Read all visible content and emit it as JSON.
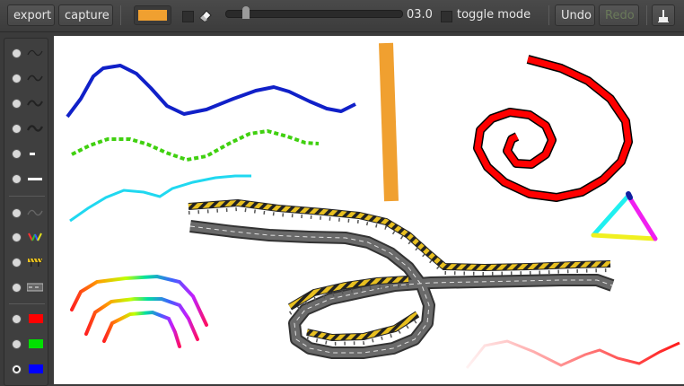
{
  "toolbar": {
    "export_label": "export",
    "capture_label": "capture",
    "current_color": "#f0a030",
    "eraser_icon": "eraser-icon",
    "brush_size": "03.0",
    "toggle_mode_label": "toggle mode",
    "undo_label": "Undo",
    "redo_label": "Redo",
    "clear_icon": "broom-icon"
  },
  "brush_panel": {
    "items": [
      {
        "id": "wave-1",
        "icon": "wave-thin-icon",
        "selected": false
      },
      {
        "id": "wave-2",
        "icon": "wave-icon",
        "selected": false
      },
      {
        "id": "wave-3",
        "icon": "wave-bold-icon",
        "selected": false
      },
      {
        "id": "wave-4",
        "icon": "wave-thick-icon",
        "selected": false
      },
      {
        "id": "dash-short",
        "icon": "dash-short-icon",
        "selected": false
      },
      {
        "id": "dash-long",
        "icon": "dash-long-icon",
        "selected": false
      },
      {
        "id": "faded-line",
        "icon": "faded-line-icon",
        "selected": false
      },
      {
        "id": "rainbow",
        "icon": "rainbow-icon",
        "selected": false
      },
      {
        "id": "barrier",
        "icon": "barrier-icon",
        "selected": false
      },
      {
        "id": "road",
        "icon": "road-icon",
        "selected": false
      },
      {
        "id": "red",
        "icon": "red-swatch-icon",
        "color": "#ff0000",
        "selected": false
      },
      {
        "id": "green",
        "icon": "green-swatch-icon",
        "color": "#00e000",
        "selected": false
      },
      {
        "id": "blue",
        "icon": "blue-swatch-icon",
        "color": "#0000ff",
        "selected": true
      }
    ]
  },
  "colors": {
    "canvas_bg": "#ffffff",
    "stroke_blue": "#1020c8",
    "stroke_green": "#40d010",
    "stroke_cyan": "#20d8f0",
    "stroke_orange": "#f0a030",
    "stroke_red": "#ff0000",
    "road_gray": "#6a6a6a",
    "barrier_yellow": "#e8c020"
  }
}
